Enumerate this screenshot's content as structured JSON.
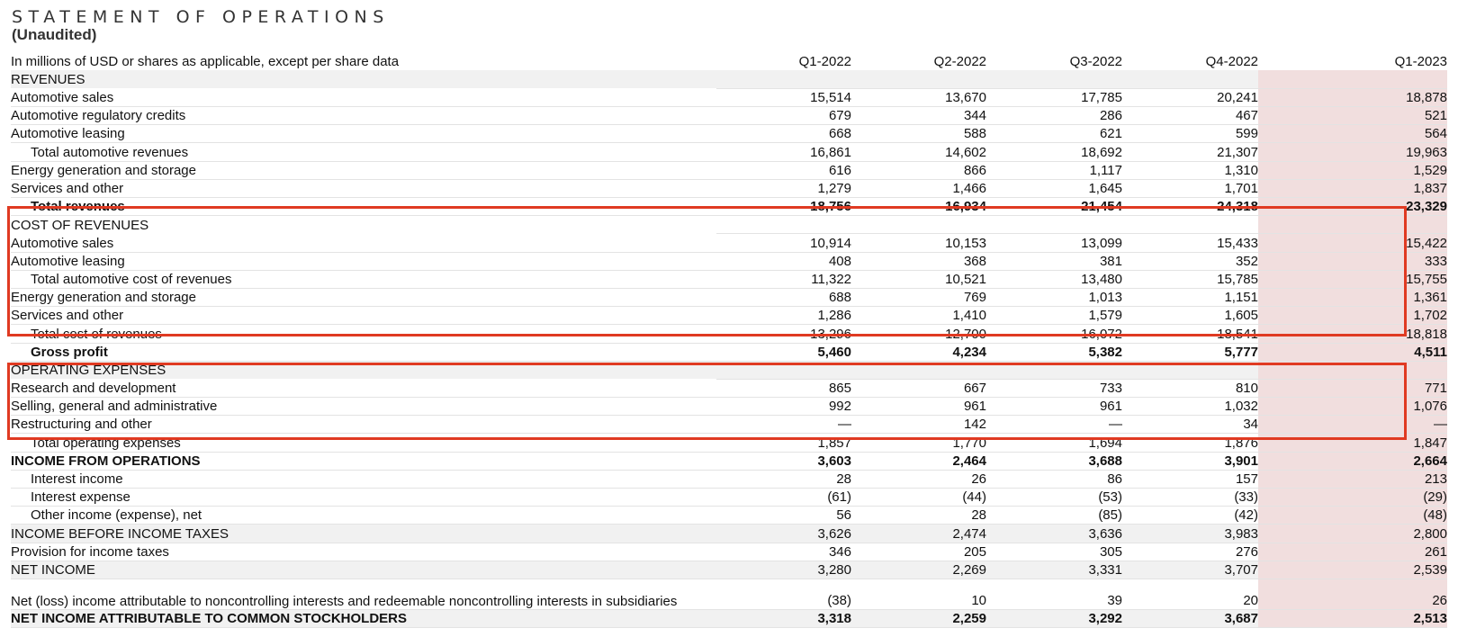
{
  "header": {
    "title": "STATEMENT OF OPERATIONS",
    "subtitle": "(Unaudited)"
  },
  "table": {
    "unit_label": "In millions of USD or shares as applicable, except per share data",
    "columns": [
      "Q1-2022",
      "Q2-2022",
      "Q3-2022",
      "Q4-2022",
      "Q1-2023"
    ],
    "rows": [
      {
        "label": "REVENUES",
        "values": [
          "",
          "",
          "",
          "",
          ""
        ]
      },
      {
        "label": "Automotive sales",
        "values": [
          "15,514",
          "13,670",
          "17,785",
          "20,241",
          "18,878"
        ]
      },
      {
        "label": "Automotive regulatory credits",
        "values": [
          "679",
          "344",
          "286",
          "467",
          "521"
        ]
      },
      {
        "label": "Automotive leasing",
        "values": [
          "668",
          "588",
          "621",
          "599",
          "564"
        ]
      },
      {
        "label": "Total automotive revenues",
        "values": [
          "16,861",
          "14,602",
          "18,692",
          "21,307",
          "19,963"
        ]
      },
      {
        "label": "Energy generation and storage",
        "values": [
          "616",
          "866",
          "1,117",
          "1,310",
          "1,529"
        ]
      },
      {
        "label": "Services and other",
        "values": [
          "1,279",
          "1,466",
          "1,645",
          "1,701",
          "1,837"
        ]
      },
      {
        "label": "Total revenues",
        "values": [
          "18,756",
          "16,934",
          "21,454",
          "24,318",
          "23,329"
        ]
      },
      {
        "label": "COST OF REVENUES",
        "values": [
          "",
          "",
          "",
          "",
          ""
        ]
      },
      {
        "label": "Automotive sales",
        "values": [
          "10,914",
          "10,153",
          "13,099",
          "15,433",
          "15,422"
        ]
      },
      {
        "label": "Automotive leasing",
        "values": [
          "408",
          "368",
          "381",
          "352",
          "333"
        ]
      },
      {
        "label": "Total automotive cost of revenues",
        "values": [
          "11,322",
          "10,521",
          "13,480",
          "15,785",
          "15,755"
        ]
      },
      {
        "label": "Energy generation and storage",
        "values": [
          "688",
          "769",
          "1,013",
          "1,151",
          "1,361"
        ]
      },
      {
        "label": "Services and other",
        "values": [
          "1,286",
          "1,410",
          "1,579",
          "1,605",
          "1,702"
        ]
      },
      {
        "label": "Total cost of revenues",
        "values": [
          "13,296",
          "12,700",
          "16,072",
          "18,541",
          "18,818"
        ]
      },
      {
        "label": "Gross profit",
        "values": [
          "5,460",
          "4,234",
          "5,382",
          "5,777",
          "4,511"
        ]
      },
      {
        "label": "OPERATING EXPENSES",
        "values": [
          "",
          "",
          "",
          "",
          ""
        ]
      },
      {
        "label": "Research and development",
        "values": [
          "865",
          "667",
          "733",
          "810",
          "771"
        ]
      },
      {
        "label": "Selling, general and administrative",
        "values": [
          "992",
          "961",
          "961",
          "1,032",
          "1,076"
        ]
      },
      {
        "label": "Restructuring and other",
        "values": [
          "—",
          "142",
          "—",
          "34",
          "—"
        ]
      },
      {
        "label": "Total operating expenses",
        "values": [
          "1,857",
          "1,770",
          "1,694",
          "1,876",
          "1,847"
        ]
      },
      {
        "label": "INCOME FROM OPERATIONS",
        "values": [
          "3,603",
          "2,464",
          "3,688",
          "3,901",
          "2,664"
        ]
      },
      {
        "label": "Interest income",
        "values": [
          "28",
          "26",
          "86",
          "157",
          "213"
        ]
      },
      {
        "label": "Interest expense",
        "values": [
          "(61)",
          "(44)",
          "(53)",
          "(33)",
          "(29)"
        ]
      },
      {
        "label": "Other income (expense), net",
        "values": [
          "56",
          "28",
          "(85)",
          "(42)",
          "(48)"
        ]
      },
      {
        "label": "INCOME BEFORE INCOME TAXES",
        "values": [
          "3,626",
          "2,474",
          "3,636",
          "3,983",
          "2,800"
        ]
      },
      {
        "label": "Provision for income taxes",
        "values": [
          "346",
          "205",
          "305",
          "276",
          "261"
        ]
      },
      {
        "label": "NET INCOME",
        "values": [
          "3,280",
          "2,269",
          "3,331",
          "3,707",
          "2,539"
        ]
      },
      {
        "label": "Net (loss) income attributable to noncontrolling interests and redeemable noncontrolling interests in subsidiaries",
        "values": [
          "(38)",
          "10",
          "39",
          "20",
          "26"
        ]
      },
      {
        "label": "NET INCOME ATTRIBUTABLE TO COMMON STOCKHOLDERS",
        "values": [
          "3,318",
          "2,259",
          "3,292",
          "3,687",
          "2,513"
        ]
      }
    ]
  },
  "colors": {
    "highlight_column": "#f1dede",
    "shaded_row": "#f1f1f1",
    "annotation_box": "#e03a22"
  }
}
